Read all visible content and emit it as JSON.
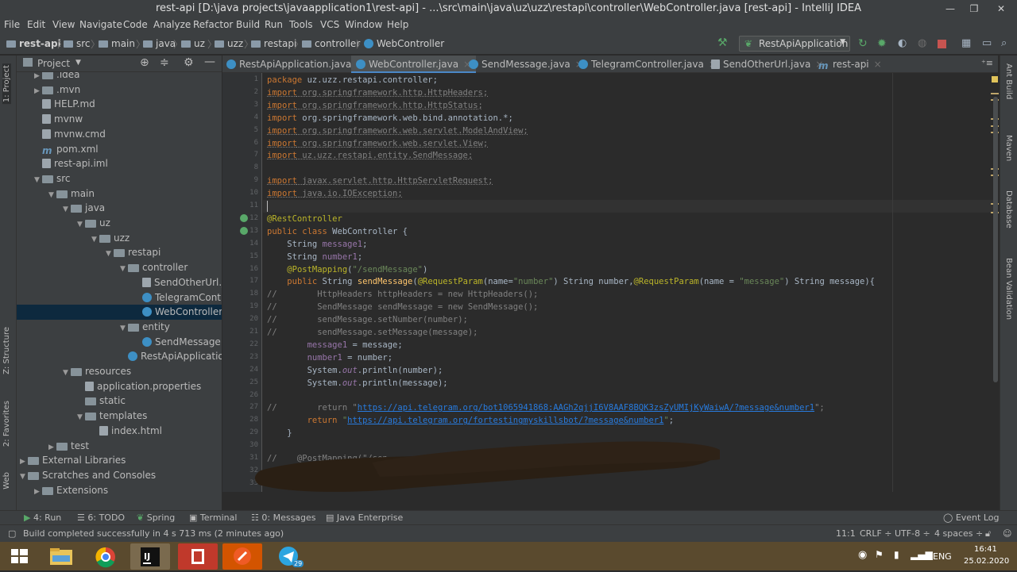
{
  "window": {
    "title": "rest-api [D:\\java projects\\javaapplication1\\rest-api] - ...\\src\\main\\java\\uz\\uzz\\restapi\\controller\\WebController.java [rest-api] - IntelliJ IDEA",
    "minimize": "—",
    "maximize": "❐",
    "close": "✕"
  },
  "menu": [
    "File",
    "Edit",
    "View",
    "Navigate",
    "Code",
    "Analyze",
    "Refactor",
    "Build",
    "Run",
    "Tools",
    "VCS",
    "Window",
    "Help"
  ],
  "breadcrumb": [
    "rest-api",
    "src",
    "main",
    "java",
    "uz",
    "uzz",
    "restapi",
    "controller",
    "WebController"
  ],
  "run_config": "RestApiApplication",
  "project_panel": {
    "title": "Project",
    "tree": [
      {
        "label": ".idea",
        "indent": 1,
        "icon": "dir",
        "arrow": "▶"
      },
      {
        "label": ".mvn",
        "indent": 1,
        "icon": "dir",
        "arrow": "▶"
      },
      {
        "label": "HELP.md",
        "indent": 1,
        "icon": "file",
        "arrow": ""
      },
      {
        "label": "mvnw",
        "indent": 1,
        "icon": "file",
        "arrow": ""
      },
      {
        "label": "mvnw.cmd",
        "indent": 1,
        "icon": "file",
        "arrow": ""
      },
      {
        "label": "pom.xml",
        "indent": 1,
        "icon": "m",
        "arrow": ""
      },
      {
        "label": "rest-api.iml",
        "indent": 1,
        "icon": "file",
        "arrow": ""
      },
      {
        "label": "src",
        "indent": 1,
        "icon": "dir",
        "arrow": "▼"
      },
      {
        "label": "main",
        "indent": 2,
        "icon": "dir",
        "arrow": "▼"
      },
      {
        "label": "java",
        "indent": 3,
        "icon": "dir",
        "arrow": "▼"
      },
      {
        "label": "uz",
        "indent": 4,
        "icon": "dir",
        "arrow": "▼"
      },
      {
        "label": "uzz",
        "indent": 5,
        "icon": "dir",
        "arrow": "▼"
      },
      {
        "label": "restapi",
        "indent": 6,
        "icon": "dir",
        "arrow": "▼"
      },
      {
        "label": "controller",
        "indent": 7,
        "icon": "dir",
        "arrow": "▼"
      },
      {
        "label": "SendOtherUrl.java",
        "indent": 8,
        "icon": "file",
        "arrow": ""
      },
      {
        "label": "TelegramController",
        "indent": 8,
        "icon": "cls",
        "arrow": ""
      },
      {
        "label": "WebController",
        "indent": 8,
        "icon": "cls",
        "arrow": "",
        "selected": true
      },
      {
        "label": "entity",
        "indent": 7,
        "icon": "dir",
        "arrow": "▼"
      },
      {
        "label": "SendMessage",
        "indent": 8,
        "icon": "cls",
        "arrow": ""
      },
      {
        "label": "RestApiApplication",
        "indent": 7,
        "icon": "cls",
        "arrow": ""
      },
      {
        "label": "resources",
        "indent": 3,
        "icon": "dir",
        "arrow": "▼"
      },
      {
        "label": "application.properties",
        "indent": 4,
        "icon": "file",
        "arrow": ""
      },
      {
        "label": "static",
        "indent": 4,
        "icon": "dir",
        "arrow": ""
      },
      {
        "label": "templates",
        "indent": 4,
        "icon": "dir",
        "arrow": "▼"
      },
      {
        "label": "index.html",
        "indent": 5,
        "icon": "file",
        "arrow": ""
      },
      {
        "label": "test",
        "indent": 2,
        "icon": "dir",
        "arrow": "▶"
      },
      {
        "label": "External Libraries",
        "indent": 0,
        "icon": "dir",
        "arrow": "▶"
      },
      {
        "label": "Scratches and Consoles",
        "indent": 0,
        "icon": "dir",
        "arrow": "▼"
      },
      {
        "label": "Extensions",
        "indent": 1,
        "icon": "dir",
        "arrow": "▶"
      }
    ]
  },
  "left_tool_tabs": [
    "1: Project",
    "Z: Structure",
    "2: Favorites",
    "Web"
  ],
  "right_tool_tabs": [
    "Ant Build",
    "Maven",
    "Database",
    "Bean Validation"
  ],
  "editor_tabs": [
    {
      "label": "RestApiApplication.java",
      "active": false
    },
    {
      "label": "WebController.java",
      "active": true
    },
    {
      "label": "SendMessage.java",
      "active": false
    },
    {
      "label": "TelegramController.java",
      "active": false
    },
    {
      "label": "SendOtherUrl.java",
      "active": false
    },
    {
      "label": "rest-api",
      "active": false
    }
  ],
  "code_lines": [
    "<span class='kw'>package</span> uz.uzz.restapi.controller;",
    "<span class='unused'><span class='kw'>import</span> org.springframework.http.HttpHeaders;</span>",
    "<span class='unused'><span class='kw'>import</span> org.springframework.http.HttpStatus;</span>",
    "<span class='kw'>import</span> org.springframework.web.bind.annotation.*;",
    "<span class='unused'><span class='kw'>import</span> org.springframework.web.servlet.ModelAndView;</span>",
    "<span class='unused'><span class='kw'>import</span> org.springframework.web.servlet.View;</span>",
    "<span class='unused'><span class='kw'>import</span> uz.uzz.restapi.entity.SendMessage;</span>",
    "",
    "<span class='unused'><span class='kw'>import</span> javax.servlet.http.HttpServletRequest;</span>",
    "<span class='unused'><span class='kw'>import</span> java.io.IOException;</span>",
    "",
    "<span class='ann'>@RestController</span>",
    "<span class='kw'>public class</span> WebController {",
    "    String <span class='fld'>message1</span>;",
    "    String <span class='fld'>number1</span>;",
    "    <span class='ann'>@PostMapping</span>(<span class='str'>\"/sendMessage\"</span>)",
    "    <span class='kw'>public</span> String <span class='mth'>sendMessage</span>(<span class='ann'>@RequestParam</span>(name=<span class='str'>\"number\"</span>) String number,<span class='ann'>@RequestParam</span>(name = <span class='str'>\"message\"</span>) String message){",
    "<span class='cm'>//        HttpHeaders httpHeaders = new HttpHeaders();</span>",
    "<span class='cm'>//        SendMessage sendMessage = new SendMessage();</span>",
    "<span class='cm'>//        sendMessage.setNumber(number);</span>",
    "<span class='cm'>//        sendMessage.setMessage(message);</span>",
    "        <span class='fld'>message1</span> = message;",
    "        <span class='fld'>number1</span> = number;",
    "        System.<span class='fld'><i>out</i></span>.println(number);",
    "        System.<span class='fld'><i>out</i></span>.println(message);",
    "",
    "<span class='cm'>//        return \"<span class='lnk'>https://api.telegram.org/bot1065941868:AAGh2qjjI6V8AAF8BQK3zsZyUMIjKyWaiwA/?message&amp;number1</span>\";</span>",
    "        <span class='kw'>return</span> <span class='str'>\"<span class='lnk'>https://api.telegram.org/fortestingmyskillsbot/?message&amp;number1</span>\"</span>;",
    "    }",
    "",
    "<span class='cm'>//    @PostMapping(\"/sen</span>",
    "",
    ""
  ],
  "bottom_tabs": [
    "4: Run",
    "6: TODO",
    "Spring",
    "Terminal",
    "0: Messages",
    "Java Enterprise",
    "Event Log"
  ],
  "status": {
    "message": "Build completed successfully in 4 s 713 ms (2 minutes ago)",
    "position": "11:1",
    "line_sep": "CRLF ÷",
    "encoding": "UTF-8 ÷",
    "indent": "4 spaces ÷"
  },
  "taskbar": {
    "lang": "ENG",
    "time": "16:41",
    "date": "25.02.2020",
    "telegram_badge": "29"
  },
  "colors": {
    "accent": "#4a88c7",
    "editor_bg": "#2b2b2b",
    "panel_bg": "#3c3f41"
  }
}
